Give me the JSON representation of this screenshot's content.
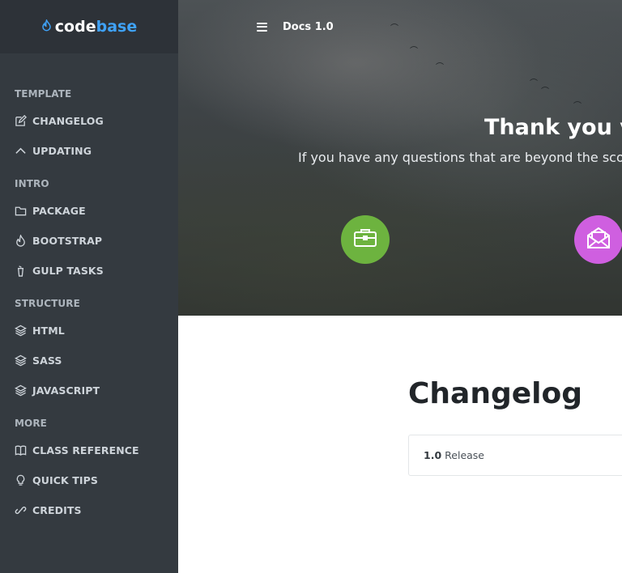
{
  "brand": {
    "code": "code",
    "base": "base",
    "icon": "flame-icon"
  },
  "header": {
    "title": "Docs 1.0",
    "menu_icon": "hamburger-icon"
  },
  "sidebar": {
    "sections": [
      {
        "title": "TEMPLATE",
        "items": [
          {
            "label": "CHANGELOG",
            "icon": "edit-icon"
          },
          {
            "label": "UPDATING",
            "icon": "chevron-up-icon"
          }
        ]
      },
      {
        "title": "INTRO",
        "items": [
          {
            "label": "PACKAGE",
            "icon": "folder-icon"
          },
          {
            "label": "BOOTSTRAP",
            "icon": "flame-icon"
          },
          {
            "label": "GULP TASKS",
            "icon": "gulp-icon"
          }
        ]
      },
      {
        "title": "STRUCTURE",
        "items": [
          {
            "label": "HTML",
            "icon": "layers-icon"
          },
          {
            "label": "SASS",
            "icon": "layers-icon"
          },
          {
            "label": "JAVASCRIPT",
            "icon": "layers-icon"
          }
        ]
      },
      {
        "title": "MORE",
        "items": [
          {
            "label": "CLASS REFERENCE",
            "icon": "book-icon"
          },
          {
            "label": "QUICK TIPS",
            "icon": "lightbulb-icon"
          },
          {
            "label": "CREDITS",
            "icon": "link-icon"
          }
        ]
      }
    ]
  },
  "hero": {
    "title": "Thank you v",
    "subtitle": "If you have any questions that are beyond the scop",
    "buttons": [
      {
        "icon": "briefcase-icon",
        "color": "#6db33f"
      },
      {
        "icon": "envelope-open-icon",
        "color": "#cf5fe0"
      }
    ]
  },
  "main": {
    "title": "Changelog",
    "release": {
      "version": "1.0",
      "label": "Release"
    }
  },
  "colors": {
    "sidebar_bg": "#343a40",
    "brand_accent": "#3fa2f7"
  }
}
